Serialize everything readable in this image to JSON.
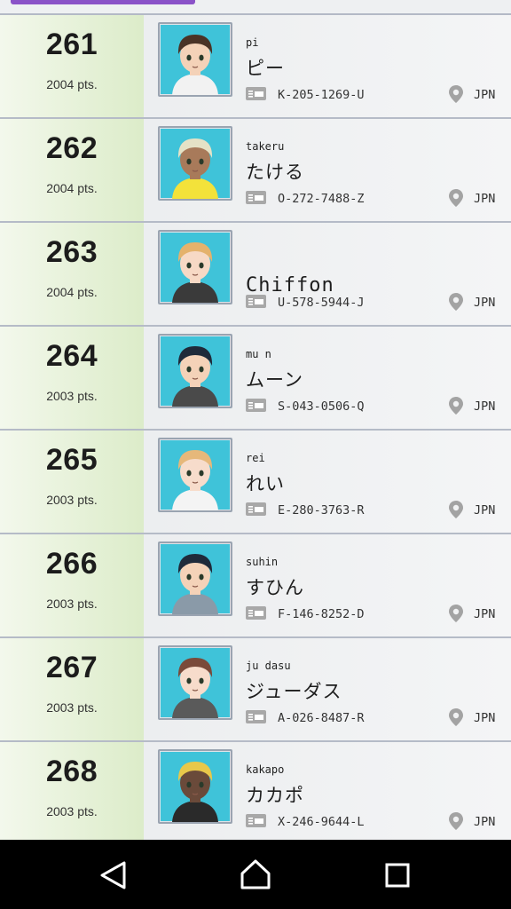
{
  "rows": [
    {
      "rank": "261",
      "points": "2004 pts.",
      "name_small": "pi",
      "name": "ピー",
      "friend_code": "K-205-1269-U",
      "country": "JPN",
      "avatar": {
        "hair": "#4a3326",
        "skin": "#f4d2b8",
        "shirt": "#f2f2f2"
      }
    },
    {
      "rank": "262",
      "points": "2004 pts.",
      "name_small": "takeru",
      "name": "たける",
      "friend_code": "O-272-7488-Z",
      "country": "JPN",
      "avatar": {
        "hair": "#e5e2c6",
        "skin": "#a87a5a",
        "shirt": "#f3e23a"
      }
    },
    {
      "rank": "263",
      "points": "2004 pts.",
      "name_small": "",
      "name": "Chiffon",
      "friend_code": "U-578-5944-J",
      "country": "JPN",
      "avatar": {
        "hair": "#e4b26c",
        "skin": "#f7d9c5",
        "shirt": "#3a3a3a"
      }
    },
    {
      "rank": "264",
      "points": "2003 pts.",
      "name_small": "mu n",
      "name": "ムーン",
      "friend_code": "S-043-0506-Q",
      "country": "JPN",
      "avatar": {
        "hair": "#1f2a3a",
        "skin": "#f4d2b8",
        "shirt": "#4a4a4a"
      }
    },
    {
      "rank": "265",
      "points": "2003 pts.",
      "name_small": "rei",
      "name": "れい",
      "friend_code": "E-280-3763-R",
      "country": "JPN",
      "avatar": {
        "hair": "#e6b87a",
        "skin": "#f7dccb",
        "shirt": "#f4f4f4"
      }
    },
    {
      "rank": "266",
      "points": "2003 pts.",
      "name_small": "suhin",
      "name": "すひん",
      "friend_code": "F-146-8252-D",
      "country": "JPN",
      "avatar": {
        "hair": "#1f2a3a",
        "skin": "#f4d2b8",
        "shirt": "#8a9aa8"
      }
    },
    {
      "rank": "267",
      "points": "2003 pts.",
      "name_small": "ju dasu",
      "name": "ジューダス",
      "friend_code": "A-026-8487-R",
      "country": "JPN",
      "avatar": {
        "hair": "#7a4a3a",
        "skin": "#f7dccb",
        "shirt": "#5a5a5a"
      }
    },
    {
      "rank": "268",
      "points": "2003 pts.",
      "name_small": "kakapo",
      "name": "カカポ",
      "friend_code": "X-246-9644-L",
      "country": "JPN",
      "avatar": {
        "hair": "#e8c84a",
        "skin": "#6a4a3a",
        "shirt": "#2a2a2a"
      }
    }
  ],
  "icons": {
    "id_card": "id-card-icon",
    "location": "location-pin-icon",
    "nav_back": "back-triangle-icon",
    "nav_home": "home-icon",
    "nav_recents": "recents-square-icon"
  },
  "colors": {
    "accent_tab": "#8a52c8",
    "rank_cell": "#dcecc9",
    "avatar_bg": "#3fc3d9",
    "navbar": "#000000"
  }
}
